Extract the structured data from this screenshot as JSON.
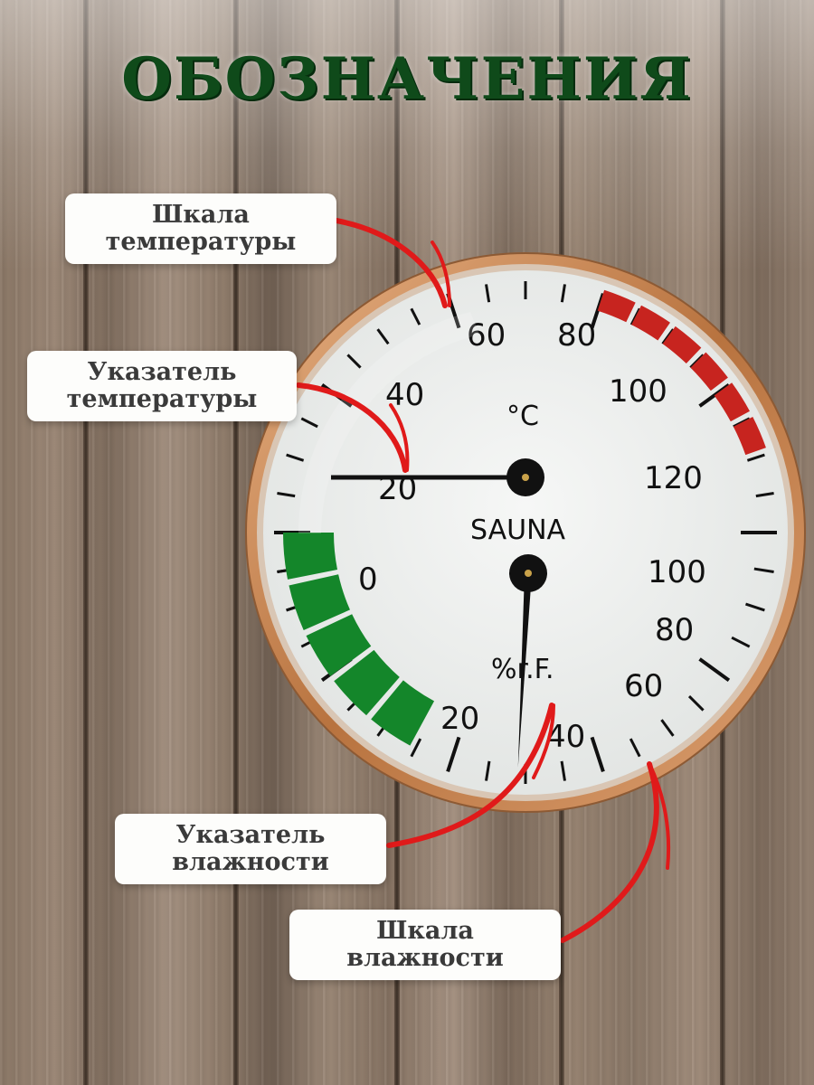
{
  "title": "ОБОЗНАЧЕНИЯ",
  "gauge": {
    "device_label": "SAUNA",
    "temperature_unit": "°C",
    "humidity_unit": "%r.F.",
    "temperature_ticks": [
      "20",
      "40",
      "60",
      "80",
      "100",
      "120"
    ],
    "humidity_ticks": [
      "0",
      "20",
      "40",
      "60",
      "80",
      "100"
    ],
    "temperature_reading_c": 20,
    "humidity_reading_percent": 40,
    "colors": {
      "ring": "#c9874f",
      "dial": "#eef0ee",
      "red_zone": "#c7241f",
      "green_zone": "#14862a",
      "arrow": "#e01a1a",
      "title": "#0f4a1a"
    }
  },
  "labels": {
    "temp_scale": {
      "line1": "Шкала",
      "line2": "температуры"
    },
    "temp_pointer": {
      "line1": "Указатель",
      "line2": "температуры"
    },
    "humidity_pointer": {
      "line1": "Указатель",
      "line2": "влажности"
    },
    "humidity_scale": {
      "line1": "Шкала",
      "line2": "влажности"
    }
  }
}
